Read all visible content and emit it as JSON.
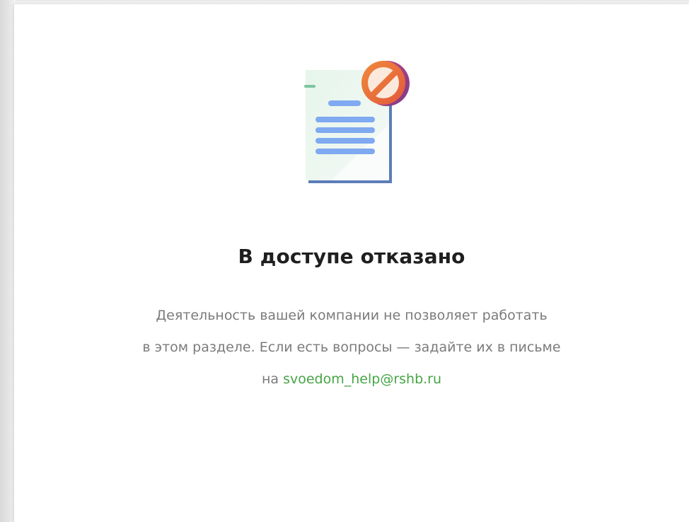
{
  "dialog": {
    "title": "В доступе отказано",
    "message_line1": "Деятельность вашей компании не позволяет работать",
    "message_line2": "в этом разделе. Если есть вопросы — задайте их в письме",
    "message_prefix": "на",
    "email": "svoedom_help@rshb.ru"
  },
  "illustration": {
    "icon": "document-access-denied-icon"
  },
  "colors": {
    "link": "#46a546",
    "title": "#1f1f1f",
    "text": "#7b7b7b",
    "document_lines": "#7fa9f0",
    "prohibition_ring": "#e9713a"
  }
}
